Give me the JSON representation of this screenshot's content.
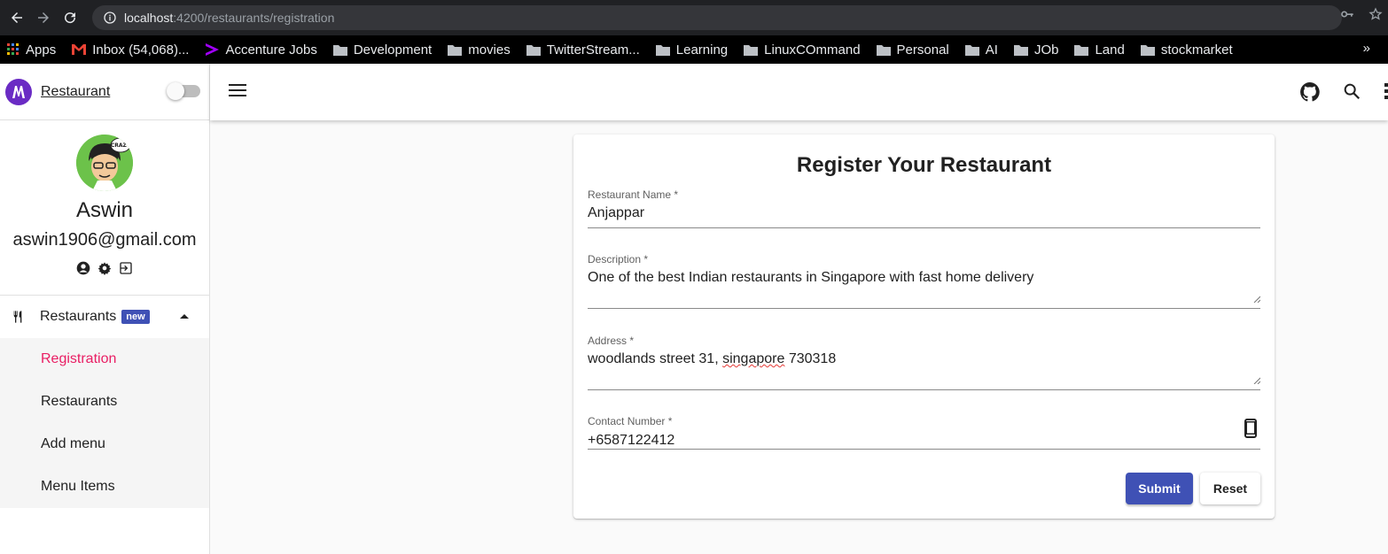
{
  "browser": {
    "url_host": "localhost",
    "url_path": ":4200/restaurants/registration",
    "bookmarks": [
      {
        "label": "Apps",
        "icon": "apps-grid-icon"
      },
      {
        "label": "Inbox (54,068)...",
        "icon": "gmail-icon"
      },
      {
        "label": "Accenture Jobs",
        "icon": "accenture-icon"
      },
      {
        "label": "Development",
        "icon": "folder-icon"
      },
      {
        "label": "movies",
        "icon": "folder-icon"
      },
      {
        "label": "TwitterStream...",
        "icon": "folder-icon"
      },
      {
        "label": "Learning",
        "icon": "folder-icon"
      },
      {
        "label": "LinuxCOmmand",
        "icon": "folder-icon"
      },
      {
        "label": "Personal",
        "icon": "folder-icon"
      },
      {
        "label": "AI",
        "icon": "folder-icon"
      },
      {
        "label": "JOb",
        "icon": "folder-icon"
      },
      {
        "label": "Land",
        "icon": "folder-icon"
      },
      {
        "label": "stockmarket",
        "icon": "folder-icon"
      }
    ],
    "more": "»"
  },
  "sidebar": {
    "brand": "Restaurant",
    "user_name": "Aswin",
    "user_email": "aswin1906@gmail.com",
    "avatar_text": "CRAZY",
    "menu_parent": "Restaurants",
    "menu_badge": "new",
    "items": [
      {
        "label": "Registration",
        "active": true
      },
      {
        "label": "Restaurants",
        "active": false
      },
      {
        "label": "Add menu",
        "active": false
      },
      {
        "label": "Menu Items",
        "active": false
      }
    ]
  },
  "form": {
    "title": "Register Your Restaurant",
    "name_label": "Restaurant Name *",
    "name_value": "Anjappar",
    "description_label": "Description *",
    "description_value": "One of the best Indian restaurants in Singapore with fast home delivery",
    "address_label": "Address *",
    "address_value_a": "woodlands street 31, ",
    "address_value_b": "singapore",
    "address_value_c": " 730318",
    "contact_label": "Contact Number *",
    "contact_value": "+6587122412",
    "submit": "Submit",
    "reset": "Reset"
  },
  "colors": {
    "primary": "#3f51b5",
    "accent": "#e91e63",
    "brand": "#6a2bc4"
  }
}
